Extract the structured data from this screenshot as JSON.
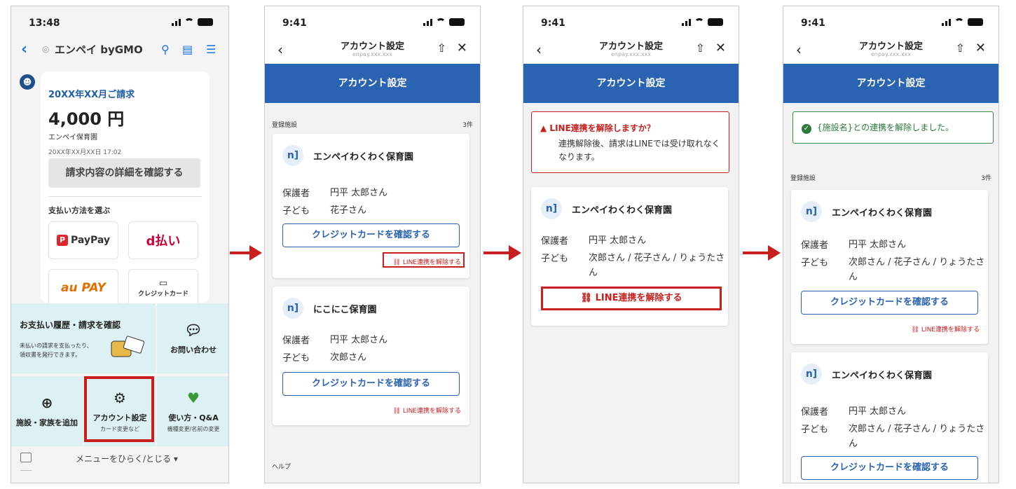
{
  "phone1": {
    "status_time": "13:48",
    "app_title": "エンペイ byGMO",
    "bill_month": "20XX年XX月ご請求",
    "amount": "4,000 円",
    "facility": "エンペイ保育園",
    "date": "20XX年XX月XX日 17:02",
    "detail_button": "請求内容の詳細を確認する",
    "pay_method_label": "支払い方法を選ぶ",
    "pay_methods": [
      "PayPay",
      "d払い",
      "au PAY",
      "クレジットカード"
    ],
    "menu": {
      "history_title": "お支払い履歴・請求を確認",
      "history_desc": "未払いの請求を支払ったり、領収書を発行できます。",
      "contact": "お問い合わせ",
      "add_facility": "施設・家族を追加",
      "account_settings": "アカウント設定",
      "account_settings_sub": "カード変更など",
      "howto": "使い方・Q&A",
      "howto_sub": "機種変更/名前の変更"
    },
    "menu_toggle": "メニューをひらく/とじる"
  },
  "settings": {
    "status_time": "9:41",
    "title": "アカウント設定",
    "url": "enpay.xxx.xxx",
    "banner": "アカウント設定",
    "registered_label": "登録施設",
    "count": "3件",
    "guardian_label": "保護者",
    "child_label": "子ども",
    "guardian_name": "円平 太郎さん",
    "cc_button": "クレジットカードを確認する",
    "unlink_link": "LINE連携を解除する",
    "help": "ヘルプ"
  },
  "phone2": {
    "cards": [
      {
        "name": "エンペイわくわく保育園",
        "child": "花子さん"
      },
      {
        "name": "にこにこ保育園",
        "child": "次郎さん"
      }
    ]
  },
  "phone3": {
    "warn_title": "LINE連携を解除しますか？",
    "warn_body": "連携解除後、請求はLINEでは受け取れなくなります。",
    "card": {
      "name": "エンペイわくわく保育園",
      "child": "次郎さん / 花子さん / りょうたさん"
    },
    "unlink_button": "LINE連携を解除する"
  },
  "phone4": {
    "success": "{施設名}との連携を解除しました。",
    "cards": [
      {
        "name": "エンペイわくわく保育園",
        "child": "次郎さん / 花子さん / りょうたさん"
      },
      {
        "name": "エンペイわくわく保育園",
        "child": "次郎さん / 花子さん / りょうたさん"
      }
    ]
  },
  "colors": {
    "accent": "#2a63b1",
    "highlight": "#c81e1e",
    "success": "#2b7a3a"
  }
}
